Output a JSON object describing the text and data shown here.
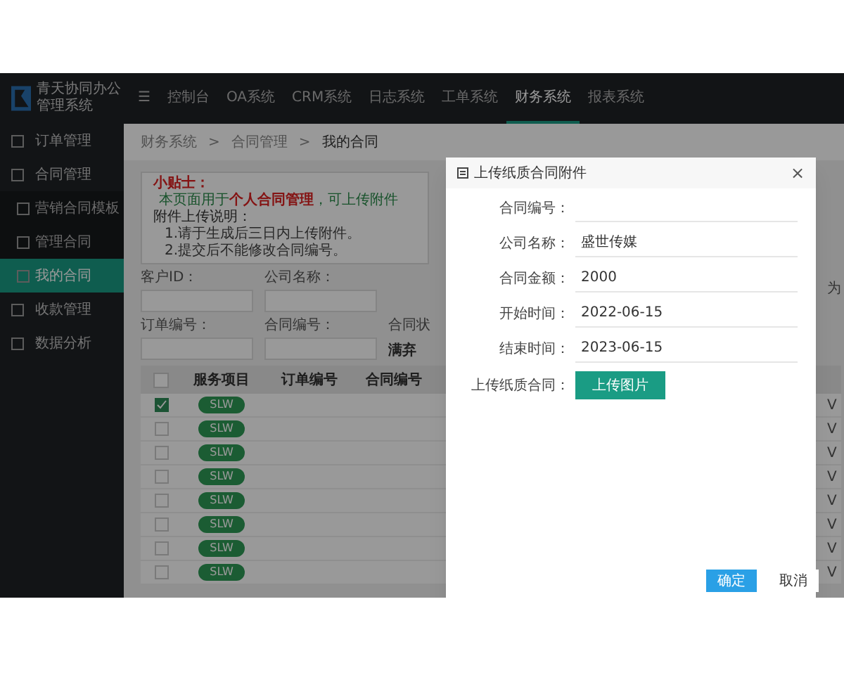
{
  "app": {
    "logo_text": [
      "青天协同办公",
      "管理系统"
    ]
  },
  "top_nav": [
    {
      "label": "☰",
      "selected": false
    },
    {
      "label": "控制台",
      "selected": false
    },
    {
      "label": "OA系统",
      "selected": false
    },
    {
      "label": "CRM系统",
      "selected": false
    },
    {
      "label": "日志系统",
      "selected": false
    },
    {
      "label": "工单系统",
      "selected": false
    },
    {
      "label": "财务系统",
      "selected": true
    },
    {
      "label": "报表系统",
      "selected": false
    }
  ],
  "sidebar": {
    "items": [
      {
        "label": "订单管理",
        "selected": false
      },
      {
        "label": "合同管理",
        "selected": false,
        "expanded": true,
        "children": [
          {
            "label": "营销合同模板",
            "selected": false
          },
          {
            "label": "管理合同",
            "selected": false
          },
          {
            "label": "我的合同",
            "selected": true
          }
        ]
      },
      {
        "label": "收款管理",
        "selected": false
      },
      {
        "label": "数据分析",
        "selected": false
      }
    ]
  },
  "breadcrumb": [
    "财务系统",
    ">",
    "合同管理",
    ">",
    "我的合同"
  ],
  "tip": {
    "title": "小贴士：",
    "lines": [
      "本页面用于**个人合同管理**，可上传附件",
      "附件上传说明：",
      "1.请于生成后三日内上传附件。",
      "2.提交后不能修改合同编号。"
    ]
  },
  "filters": [
    {
      "label": "客户ID："
    },
    {
      "label": "公司名称："
    },
    {
      "label": "订单编号："
    },
    {
      "label": "合同编号："
    },
    {
      "label": "合同状"
    }
  ],
  "filter_value": "满弃",
  "table": {
    "all_checked": false,
    "columns": [
      "服务项目",
      "订单编号",
      "合同编号"
    ],
    "rows": [
      {
        "checked": true,
        "tag": "SLW",
        "column_4": "V"
      },
      {
        "checked": false,
        "tag": "SLW",
        "column_4": "V"
      },
      {
        "checked": false,
        "tag": "SLW",
        "column_4": "V"
      },
      {
        "checked": false,
        "tag": "SLW",
        "column_4": "V"
      },
      {
        "checked": false,
        "tag": "SLW",
        "column_4": "V"
      },
      {
        "checked": false,
        "tag": "SLW",
        "column_4": "V"
      },
      {
        "checked": false,
        "tag": "SLW",
        "column_4": "V"
      },
      {
        "checked": false,
        "tag": "SLW",
        "column_4": "V"
      }
    ]
  },
  "side_text": "为",
  "dialog": {
    "title": "上传纸质合同附件",
    "close": "×",
    "fields": [
      {
        "label": "合同编号："
      },
      {
        "label": "公司名称：",
        "value": "盛世传媒"
      },
      {
        "label": "合同金额：",
        "value": "2000"
      },
      {
        "label": "开始时间：",
        "value": "2022-06-15"
      },
      {
        "label": "结束时间：",
        "value": "2023-06-15"
      }
    ],
    "upload": {
      "label": "上传纸质合同：",
      "button": "上传图片"
    },
    "buttons": [
      {
        "label": "确定",
        "kind": "primary"
      },
      {
        "label": "取消",
        "kind": "plain"
      }
    ]
  }
}
